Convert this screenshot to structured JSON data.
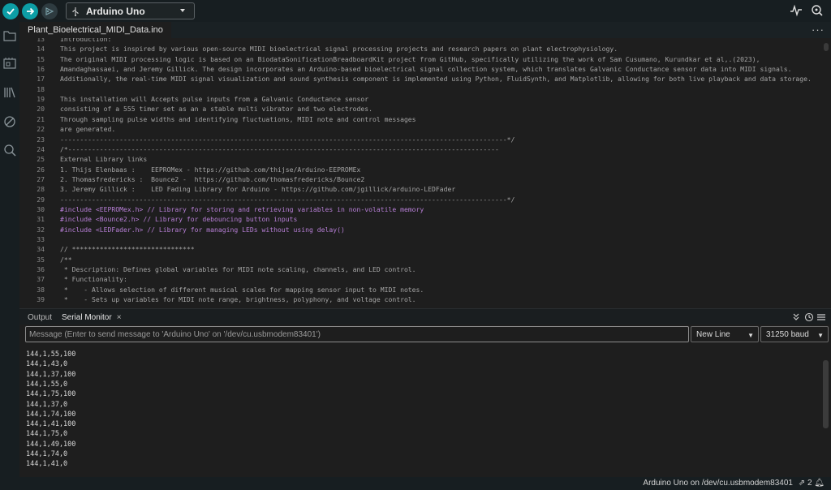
{
  "toolbar": {
    "board_name": "Arduino Uno",
    "icons": [
      "verify-icon",
      "upload-icon",
      "debugger-icon",
      "usb-icon",
      "serial-plotter-icon",
      "serial-monitor-icon"
    ]
  },
  "sidebar": {
    "icons": [
      "sketchbook-icon",
      "boards-manager-icon",
      "library-manager-icon",
      "debug-icon",
      "search-icon",
      "account-icon"
    ]
  },
  "editor": {
    "tab_label": "Plant_Bioelectrical_MIDI_Data.ino",
    "more_label": "···",
    "lines": [
      {
        "n": "13",
        "text": "Introduction:"
      },
      {
        "n": "14",
        "text": "This project is inspired by various open-source MIDI bioelectrical signal processing projects and research papers on plant electrophysiology."
      },
      {
        "n": "15",
        "text": "The original MIDI processing logic is based on an BiodataSonificationBreadboardKit project from GitHub, specifically utilizing the work of Sam Cusumano, Kurundkar et al,.(2023),"
      },
      {
        "n": "16",
        "text": "Amandaghassaei, and Jeremy Gillick. The design incorporates an Arduino-based bioelectrical signal collection system, which translates Galvanic Conductance sensor data into MIDI signals."
      },
      {
        "n": "17",
        "text": "Additionally, the real-time MIDI signal visualization and sound synthesis component is implemented using Python, FluidSynth, and Matplotlib, allowing for both live playback and data storage."
      },
      {
        "n": "18",
        "text": ""
      },
      {
        "n": "19",
        "text": "This installation will Accepts pulse inputs from a Galvanic Conductance sensor"
      },
      {
        "n": "20",
        "text": "consisting of a 555 timer set as an a stable multi vibrator and two electrodes."
      },
      {
        "n": "21",
        "text": "Through sampling pulse widths and identifying fluctuations, MIDI note and control messages"
      },
      {
        "n": "22",
        "text": "are generated."
      },
      {
        "n": "23",
        "text": "-----------------------------------------------------------------------------------------------------------------*/"
      },
      {
        "n": "24",
        "text": "/*-------------------------------------------------------------------------------------------------------------"
      },
      {
        "n": "25",
        "text": "External Library links"
      },
      {
        "n": "26",
        "text": "1. Thijs Elenbaas :    EEPROMex - https://github.com/thijse/Arduino-EEPROMEx"
      },
      {
        "n": "27",
        "text": "2. Thomasfredericks :  Bounce2 -  https://github.com/thomasfredericks/Bounce2"
      },
      {
        "n": "28",
        "text": "3. Jeremy Gillick :    LED Fading Library for Arduino - https://github.com/jgillick/arduino-LEDFader"
      },
      {
        "n": "29",
        "text": "-----------------------------------------------------------------------------------------------------------------*/"
      },
      {
        "n": "30",
        "text": "#include <EEPROMex.h> // Library for storing and retrieving variables in non-volatile memory"
      },
      {
        "n": "31",
        "text": "#include <Bounce2.h> // Library for debouncing button inputs"
      },
      {
        "n": "32",
        "text": "#include <LEDFader.h> // Library for managing LEDs without using delay()"
      },
      {
        "n": "33",
        "text": ""
      },
      {
        "n": "34",
        "text": "// *******************************"
      },
      {
        "n": "35",
        "text": "/**"
      },
      {
        "n": "36",
        "text": " * Description: Defines global variables for MIDI note scaling, channels, and LED control."
      },
      {
        "n": "37",
        "text": " * Functionality:"
      },
      {
        "n": "38",
        "text": " *    - Allows selection of different musical scales for mapping sensor input to MIDI notes."
      },
      {
        "n": "39",
        "text": " *    - Sets up variables for MIDI note range, brightness, polyphony, and voltage control."
      }
    ]
  },
  "panel": {
    "tab_output": "Output",
    "tab_serial": "Serial Monitor",
    "close_glyph": "×",
    "message_placeholder": "Message (Enter to send message to 'Arduino Uno' on '/dev/cu.usbmodem83401')",
    "line_ending": "New Line",
    "baud_rate": "31250 baud",
    "serial_output": [
      "144,1,55,100",
      "144,1,43,0",
      "144,1,37,100",
      "144,1,55,0",
      "144,1,75,100",
      "144,1,37,0",
      "144,1,74,100",
      "144,1,41,100",
      "144,1,75,0",
      "144,1,49,100",
      "144,1,74,0",
      "144,1,41,0"
    ]
  },
  "statusbar": {
    "connection": "Arduino Uno on /dev/cu.usbmodem83401",
    "notifications": "2"
  }
}
